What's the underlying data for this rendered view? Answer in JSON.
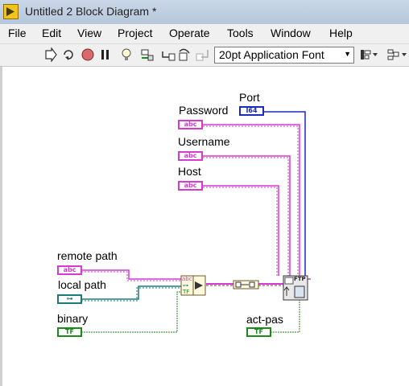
{
  "window": {
    "title": "Untitled 2 Block Diagram *"
  },
  "menu": {
    "items": [
      "File",
      "Edit",
      "View",
      "Project",
      "Operate",
      "Tools",
      "Window",
      "Help"
    ]
  },
  "toolbar": {
    "font": "20pt Application Font",
    "buttons": [
      "run-arrow-icon",
      "run-continuously-icon",
      "abort-icon",
      "pause-icon",
      "highlight-execution-icon",
      "retain-wire-values-icon",
      "step-into-icon",
      "step-over-icon",
      "step-out-icon",
      "align-objects-icon",
      "distribute-objects-icon"
    ]
  },
  "diagram": {
    "controls": [
      {
        "label": "Port",
        "type": "I64",
        "terminal_text": "I64"
      },
      {
        "label": "Password",
        "type": "string",
        "terminal_text": "abc"
      },
      {
        "label": "Username",
        "type": "string",
        "terminal_text": "abc"
      },
      {
        "label": "Host",
        "type": "string",
        "terminal_text": "abc"
      },
      {
        "label": "remote path",
        "type": "string",
        "terminal_text": "abc"
      },
      {
        "label": "local path",
        "type": "path",
        "terminal_text": "⊶"
      },
      {
        "label": "binary",
        "type": "boolean",
        "terminal_text": "TF"
      },
      {
        "label": "act-pas",
        "type": "boolean",
        "terminal_text": "TF"
      }
    ],
    "nodes": {
      "bundle_rows": [
        "abc",
        "⊶",
        "TF"
      ],
      "ftp_label": "FTP"
    },
    "wire_colors": {
      "string": "#d63ad1",
      "integer": "#1b2bbd",
      "path": "#1b7a7a",
      "boolean": "#1c8a1c",
      "cluster": "#8b3a3a"
    }
  }
}
